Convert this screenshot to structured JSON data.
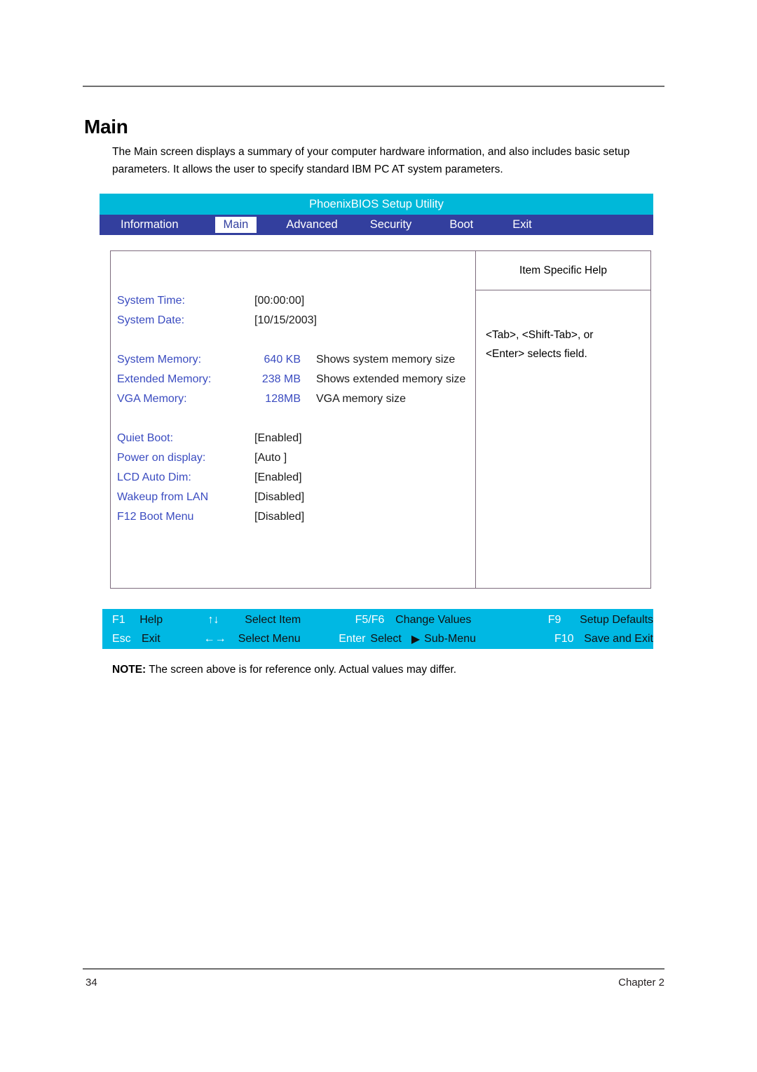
{
  "document": {
    "page_title": "Main",
    "intro": "The Main screen displays a summary of your computer hardware information, and also includes basic setup parameters. It allows the user to specify standard IBM PC AT system parameters.",
    "note_prefix": "NOTE:",
    "note_text": " The screen above is for reference only. Actual values may differ.",
    "page_number": "34",
    "chapter_label": "Chapter 2"
  },
  "bios": {
    "title": "PhoenixBIOS Setup Utility",
    "tabs": [
      {
        "label": "Information",
        "active": false
      },
      {
        "label": "Main",
        "active": true
      },
      {
        "label": "Advanced",
        "active": false
      },
      {
        "label": "Security",
        "active": false
      },
      {
        "label": "Boot",
        "active": false
      },
      {
        "label": "Exit",
        "active": false
      }
    ],
    "settings": [
      {
        "label": "System Time:",
        "value": "[00:00:00]",
        "desc": ""
      },
      {
        "label": "System Date:",
        "value": "[10/15/2003]",
        "desc": ""
      },
      {
        "label": "System Memory:",
        "value": "640 KB",
        "desc": "Shows system memory size"
      },
      {
        "label": "Extended Memory:",
        "value": "238 MB",
        "desc": "Shows extended memory size"
      },
      {
        "label": "VGA Memory:",
        "value": "128MB",
        "desc": "VGA memory size"
      },
      {
        "label": "Quiet Boot:",
        "value": "[Enabled]",
        "desc": ""
      },
      {
        "label": "Power on display:",
        "value": "[Auto ]",
        "desc": ""
      },
      {
        "label": "LCD Auto Dim:",
        "value": "[Enabled]",
        "desc": ""
      },
      {
        "label": "Wakeup from LAN",
        "value": "[Disabled]",
        "desc": ""
      },
      {
        "label": "F12 Boot Menu",
        "value": "[Disabled]",
        "desc": ""
      }
    ],
    "help": {
      "header": "Item Specific Help",
      "line1": "<Tab>, <Shift-Tab>, or",
      "line2": "<Enter> selects field."
    },
    "function_keys": [
      {
        "key": "F1",
        "desc": "Help"
      },
      {
        "key": "↑↓",
        "desc": "Select Item"
      },
      {
        "key": "F5/F6",
        "desc": "Change Values"
      },
      {
        "key": "F9",
        "desc": "Setup Defaults"
      },
      {
        "key": "Esc",
        "desc": "Exit"
      },
      {
        "key": "←→",
        "desc": "Select Menu"
      },
      {
        "key": "Enter",
        "desc": "Select"
      },
      {
        "key": "F10",
        "desc": "Save and Exit"
      }
    ],
    "submenu_glyph": "▶",
    "submenu_label": "Sub-Menu",
    "colors": {
      "titlebar": "#00b8d9",
      "tabbar": "#333f9e",
      "fnbar": "#00b8e3",
      "label_blue": "#3b4cc0"
    }
  }
}
